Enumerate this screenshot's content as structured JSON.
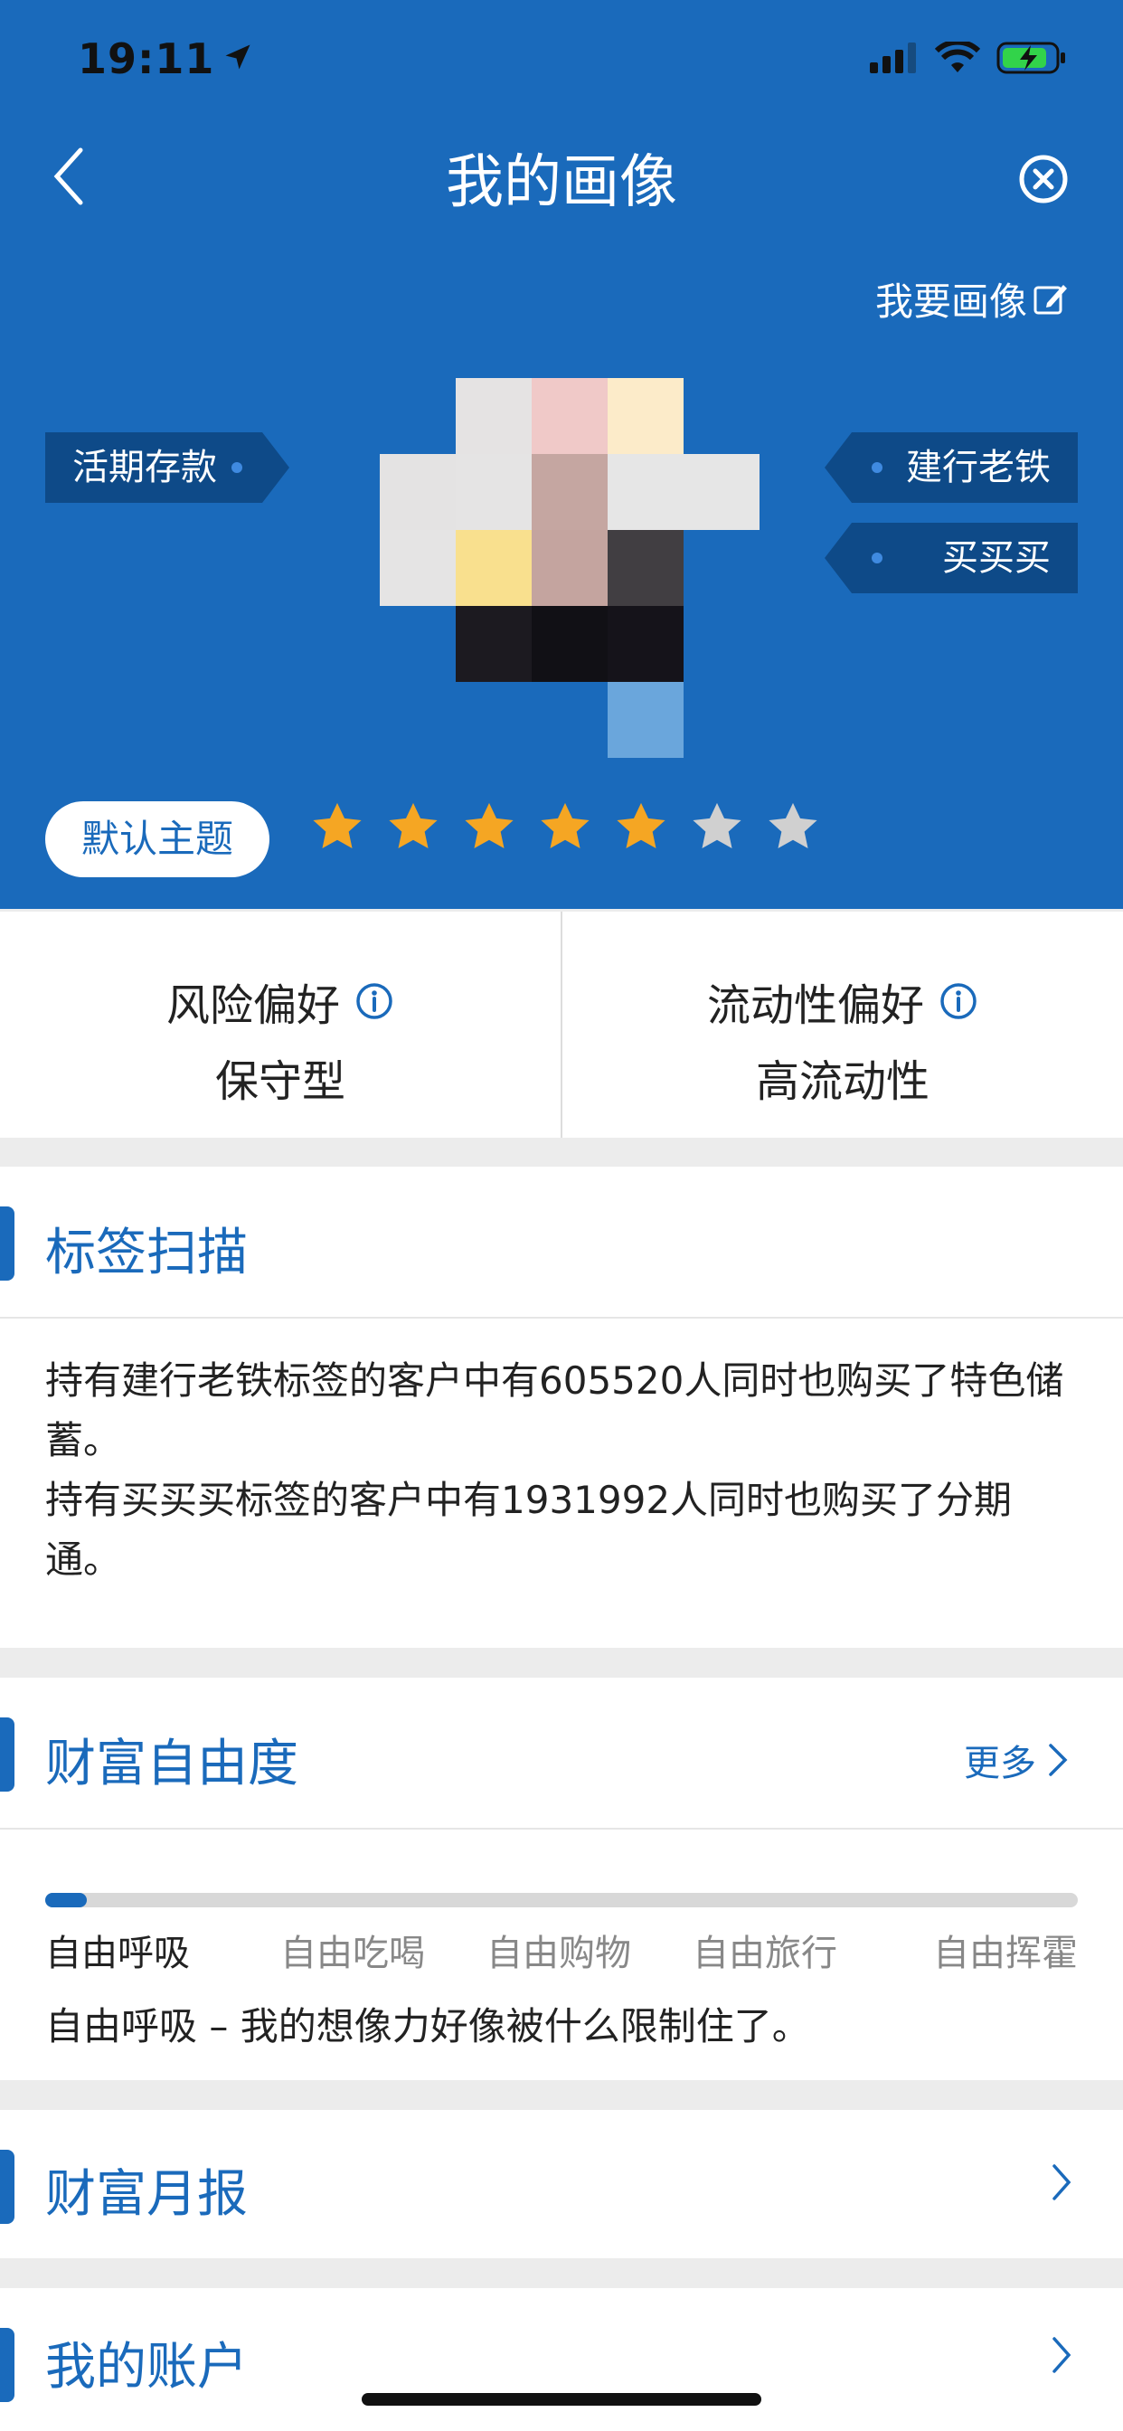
{
  "status_bar": {
    "time": "19:11"
  },
  "header": {
    "title": "我的画像",
    "edit_link": "我要画像"
  },
  "tags": {
    "left": [
      "活期存款"
    ],
    "right": [
      "建行老铁",
      "买买买"
    ]
  },
  "theme": {
    "label": "默认主题",
    "rating": 5,
    "max_rating": 7
  },
  "preferences": [
    {
      "label": "风险偏好",
      "value": "保守型"
    },
    {
      "label": "流动性偏好",
      "value": "高流动性"
    }
  ],
  "tag_scan": {
    "title": "标签扫描",
    "lines": [
      "持有建行老铁标签的客户中有605520人同时也购买了特色储蓄。",
      "持有买买买标签的客户中有1931992人同时也购买了分期通。"
    ]
  },
  "wealth_freedom": {
    "title": "财富自由度",
    "more": "更多",
    "progress": 0.04,
    "levels": [
      "自由呼吸",
      "自由吃喝",
      "自由购物",
      "自由旅行",
      "自由挥霍"
    ],
    "current_level": 0,
    "description": "自由呼吸 – 我的想像力好像被什么限制住了。"
  },
  "monthly_report": {
    "title": "财富月报"
  },
  "my_account": {
    "title": "我的账户"
  },
  "colors": {
    "primary": "#1a6abb",
    "tag_bg": "#0e4a88",
    "star_on": "#f5a623",
    "star_off": "#d0d0d0"
  }
}
